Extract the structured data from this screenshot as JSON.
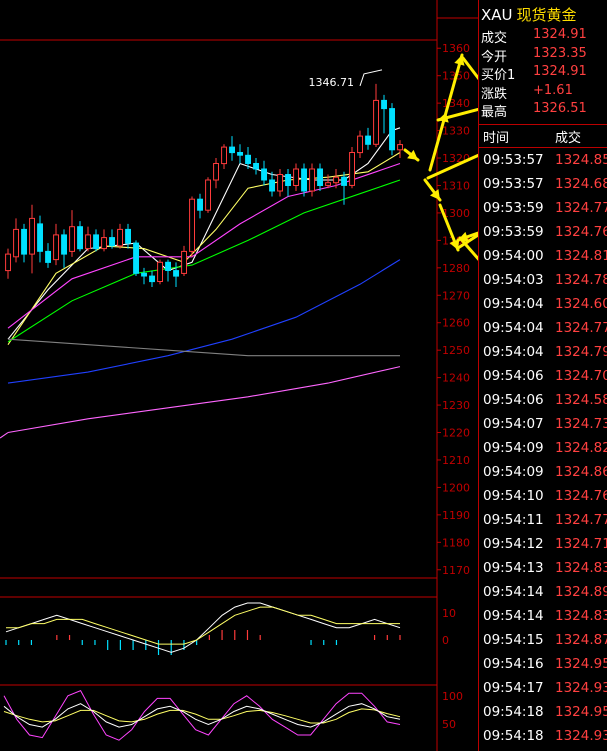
{
  "quote": {
    "symbol": "XAU",
    "name": "现货黄金",
    "rows": [
      {
        "label": "成交",
        "value": "1324.91"
      },
      {
        "label": "今开",
        "value": "1323.35"
      },
      {
        "label": "买价1",
        "value": "1324.91"
      },
      {
        "label": "涨跌",
        "value": "+1.61"
      },
      {
        "label": "最高",
        "value": "1326.51"
      }
    ]
  },
  "trades": {
    "headers": [
      "时间",
      "成交"
    ],
    "rows": [
      {
        "time": "09:53:57",
        "price": "1324.85"
      },
      {
        "time": "09:53:57",
        "price": "1324.68"
      },
      {
        "time": "09:53:59",
        "price": "1324.77"
      },
      {
        "time": "09:53:59",
        "price": "1324.76"
      },
      {
        "time": "09:54:00",
        "price": "1324.81"
      },
      {
        "time": "09:54:03",
        "price": "1324.78"
      },
      {
        "time": "09:54:04",
        "price": "1324.60"
      },
      {
        "time": "09:54:04",
        "price": "1324.77"
      },
      {
        "time": "09:54:04",
        "price": "1324.79"
      },
      {
        "time": "09:54:06",
        "price": "1324.70"
      },
      {
        "time": "09:54:06",
        "price": "1324.58"
      },
      {
        "time": "09:54:07",
        "price": "1324.73"
      },
      {
        "time": "09:54:09",
        "price": "1324.82"
      },
      {
        "time": "09:54:09",
        "price": "1324.86"
      },
      {
        "time": "09:54:10",
        "price": "1324.76"
      },
      {
        "time": "09:54:11",
        "price": "1324.77"
      },
      {
        "time": "09:54:12",
        "price": "1324.71"
      },
      {
        "time": "09:54:13",
        "price": "1324.83"
      },
      {
        "time": "09:54:14",
        "price": "1324.89"
      },
      {
        "time": "09:54:14",
        "price": "1324.83"
      },
      {
        "time": "09:54:15",
        "price": "1324.87"
      },
      {
        "time": "09:54:16",
        "price": "1324.95"
      },
      {
        "time": "09:54:17",
        "price": "1324.93"
      },
      {
        "time": "09:54:18",
        "price": "1324.95"
      },
      {
        "time": "09:54:18",
        "price": "1324.93"
      }
    ]
  },
  "colors": {
    "up": "#ff3b3b",
    "down": "#00e0ff",
    "axis": "#c00000",
    "ma5": "#ffffff",
    "ma10": "#ffff66",
    "ma20": "#ff44ff",
    "ma30": "#00ff00",
    "ma60": "#2040ff",
    "ma120": "#808080",
    "ma250": "#ff66ff",
    "arrow": "#ffee00"
  },
  "chart_data": {
    "type": "candlestick",
    "price_axis_ticks": [
      1360,
      1350,
      1340,
      1330,
      1320,
      1310,
      1300,
      1290,
      1280,
      1270,
      1260,
      1250,
      1240,
      1230,
      1220,
      1210,
      1200,
      1190,
      1180,
      1170
    ],
    "ylim": [
      1167,
      1363
    ],
    "peak_label": "1346.71",
    "candles": [
      {
        "o": 1279,
        "c": 1285,
        "h": 1287,
        "l": 1276
      },
      {
        "o": 1284,
        "c": 1294,
        "h": 1298,
        "l": 1282
      },
      {
        "o": 1294,
        "c": 1285,
        "h": 1296,
        "l": 1282
      },
      {
        "o": 1285,
        "c": 1298,
        "h": 1303,
        "l": 1278
      },
      {
        "o": 1296,
        "c": 1286,
        "h": 1299,
        "l": 1282
      },
      {
        "o": 1286,
        "c": 1282,
        "h": 1289,
        "l": 1280
      },
      {
        "o": 1283,
        "c": 1292,
        "h": 1296,
        "l": 1281
      },
      {
        "o": 1292,
        "c": 1285,
        "h": 1294,
        "l": 1280
      },
      {
        "o": 1286,
        "c": 1295,
        "h": 1301,
        "l": 1284
      },
      {
        "o": 1295,
        "c": 1287,
        "h": 1297,
        "l": 1286
      },
      {
        "o": 1287,
        "c": 1292,
        "h": 1295,
        "l": 1286
      },
      {
        "o": 1292,
        "c": 1287,
        "h": 1294,
        "l": 1286
      },
      {
        "o": 1287,
        "c": 1291,
        "h": 1294,
        "l": 1286
      },
      {
        "o": 1291,
        "c": 1288,
        "h": 1294,
        "l": 1287
      },
      {
        "o": 1288,
        "c": 1294,
        "h": 1296,
        "l": 1287
      },
      {
        "o": 1294,
        "c": 1289,
        "h": 1296,
        "l": 1287
      },
      {
        "o": 1289,
        "c": 1278,
        "h": 1290,
        "l": 1277
      },
      {
        "o": 1278,
        "c": 1277,
        "h": 1280,
        "l": 1274
      },
      {
        "o": 1277,
        "c": 1275,
        "h": 1279,
        "l": 1273
      },
      {
        "o": 1275,
        "c": 1282,
        "h": 1283,
        "l": 1274
      },
      {
        "o": 1282,
        "c": 1279,
        "h": 1283,
        "l": 1275
      },
      {
        "o": 1279,
        "c": 1277,
        "h": 1282,
        "l": 1273
      },
      {
        "o": 1278,
        "c": 1286,
        "h": 1288,
        "l": 1277
      },
      {
        "o": 1286,
        "c": 1305,
        "h": 1306,
        "l": 1284
      },
      {
        "o": 1305,
        "c": 1301,
        "h": 1307,
        "l": 1298
      },
      {
        "o": 1301,
        "c": 1312,
        "h": 1313,
        "l": 1300
      },
      {
        "o": 1312,
        "c": 1318,
        "h": 1320,
        "l": 1309
      },
      {
        "o": 1318,
        "c": 1324,
        "h": 1325,
        "l": 1316
      },
      {
        "o": 1324,
        "c": 1322,
        "h": 1328,
        "l": 1319
      },
      {
        "o": 1322,
        "c": 1321,
        "h": 1325,
        "l": 1318
      },
      {
        "o": 1321,
        "c": 1318,
        "h": 1324,
        "l": 1316
      },
      {
        "o": 1318,
        "c": 1316,
        "h": 1320,
        "l": 1314
      },
      {
        "o": 1316,
        "c": 1312,
        "h": 1319,
        "l": 1310
      },
      {
        "o": 1312,
        "c": 1308,
        "h": 1315,
        "l": 1306
      },
      {
        "o": 1308,
        "c": 1314,
        "h": 1316,
        "l": 1306
      },
      {
        "o": 1314,
        "c": 1310,
        "h": 1316,
        "l": 1306
      },
      {
        "o": 1310,
        "c": 1316,
        "h": 1318,
        "l": 1308
      },
      {
        "o": 1316,
        "c": 1308,
        "h": 1318,
        "l": 1306
      },
      {
        "o": 1308,
        "c": 1316,
        "h": 1318,
        "l": 1306
      },
      {
        "o": 1316,
        "c": 1310,
        "h": 1318,
        "l": 1308
      },
      {
        "o": 1310,
        "c": 1311,
        "h": 1314,
        "l": 1309
      },
      {
        "o": 1311,
        "c": 1313,
        "h": 1316,
        "l": 1309
      },
      {
        "o": 1313,
        "c": 1310,
        "h": 1315,
        "l": 1303
      },
      {
        "o": 1310,
        "c": 1322,
        "h": 1324,
        "l": 1309
      },
      {
        "o": 1322,
        "c": 1328,
        "h": 1330,
        "l": 1320
      },
      {
        "o": 1328,
        "c": 1325,
        "h": 1331,
        "l": 1323
      },
      {
        "o": 1325,
        "c": 1341,
        "h": 1347,
        "l": 1324
      },
      {
        "o": 1341,
        "c": 1338,
        "h": 1343,
        "l": 1329
      },
      {
        "o": 1338,
        "c": 1323,
        "h": 1340,
        "l": 1321
      },
      {
        "o": 1323,
        "c": 1324.91,
        "h": 1326.51,
        "l": 1320
      }
    ],
    "ma_lines": [
      {
        "key": "ma5",
        "points": [
          [
            0,
            1254
          ],
          [
            5,
            1272
          ],
          [
            10,
            1287
          ],
          [
            16,
            1289
          ],
          [
            20,
            1279
          ],
          [
            23,
            1282
          ],
          [
            26,
            1300
          ],
          [
            29,
            1318
          ],
          [
            33,
            1314
          ],
          [
            38,
            1312
          ],
          [
            42,
            1312
          ],
          [
            45,
            1318
          ],
          [
            48,
            1330
          ],
          [
            49,
            1331
          ]
        ]
      },
      {
        "key": "ma10",
        "points": [
          [
            0,
            1252
          ],
          [
            6,
            1278
          ],
          [
            12,
            1288
          ],
          [
            17,
            1287
          ],
          [
            22,
            1282
          ],
          [
            26,
            1294
          ],
          [
            30,
            1309
          ],
          [
            35,
            1312
          ],
          [
            40,
            1313
          ],
          [
            45,
            1315
          ],
          [
            49,
            1322
          ]
        ]
      },
      {
        "key": "ma20",
        "points": [
          [
            0,
            1258
          ],
          [
            8,
            1276
          ],
          [
            16,
            1284
          ],
          [
            23,
            1284
          ],
          [
            29,
            1296
          ],
          [
            35,
            1306
          ],
          [
            41,
            1310
          ],
          [
            46,
            1315
          ],
          [
            49,
            1318
          ]
        ]
      },
      {
        "key": "ma30",
        "points": [
          [
            0,
            1253
          ],
          [
            8,
            1268
          ],
          [
            16,
            1278
          ],
          [
            23,
            1281
          ],
          [
            30,
            1290
          ],
          [
            37,
            1300
          ],
          [
            44,
            1307
          ],
          [
            49,
            1312
          ]
        ]
      },
      {
        "key": "ma60",
        "points": [
          [
            0,
            1238
          ],
          [
            10,
            1242
          ],
          [
            20,
            1248
          ],
          [
            28,
            1254
          ],
          [
            36,
            1262
          ],
          [
            44,
            1274
          ],
          [
            49,
            1283
          ]
        ]
      },
      {
        "key": "ma120",
        "points": [
          [
            0,
            1254
          ],
          [
            10,
            1252
          ],
          [
            20,
            1250
          ],
          [
            30,
            1248
          ],
          [
            40,
            1248
          ],
          [
            49,
            1248
          ]
        ]
      },
      {
        "key": "ma250",
        "points": [
          [
            0,
            1220
          ],
          [
            10,
            1225
          ],
          [
            20,
            1229
          ],
          [
            30,
            1233
          ],
          [
            40,
            1238
          ],
          [
            49,
            1244
          ]
        ]
      }
    ],
    "macd": {
      "axis_ticks": [
        10,
        0
      ],
      "dif": [
        2,
        3,
        4,
        5,
        6,
        5,
        4,
        3,
        2,
        1,
        0,
        -1,
        -2,
        -3,
        -2,
        0,
        3,
        6,
        8,
        9,
        9,
        8,
        7,
        6,
        5,
        4,
        3,
        3,
        4,
        5,
        4,
        3
      ],
      "dea": [
        3,
        3,
        4,
        4,
        5,
        5,
        5,
        4,
        3,
        2,
        1,
        0,
        -1,
        -1,
        -1,
        0,
        2,
        4,
        6,
        7,
        8,
        8,
        7,
        6,
        6,
        5,
        4,
        4,
        4,
        4,
        4,
        4
      ],
      "bars": [
        -1,
        -1,
        -1,
        0,
        1,
        1,
        -1,
        -1,
        -2,
        -2,
        -2,
        -2,
        -3,
        -3,
        -2,
        -1,
        1,
        2,
        2,
        2,
        1,
        0,
        0,
        0,
        -1,
        -1,
        -1,
        0,
        0,
        1,
        1,
        1
      ]
    },
    "kdj": {
      "axis_ticks": [
        100,
        50
      ],
      "k": [
        80,
        60,
        45,
        40,
        55,
        75,
        85,
        70,
        50,
        40,
        45,
        60,
        75,
        80,
        70,
        55,
        45,
        55,
        70,
        80,
        75,
        65,
        55,
        45,
        40,
        50,
        65,
        80,
        85,
        75,
        60,
        55
      ],
      "d": [
        70,
        62,
        55,
        50,
        52,
        62,
        72,
        72,
        62,
        52,
        50,
        55,
        65,
        72,
        72,
        65,
        55,
        55,
        62,
        70,
        72,
        68,
        62,
        55,
        48,
        48,
        55,
        68,
        75,
        73,
        66,
        60
      ],
      "j": [
        100,
        55,
        25,
        20,
        60,
        100,
        110,
        65,
        25,
        15,
        35,
        70,
        95,
        95,
        65,
        35,
        25,
        55,
        85,
        100,
        80,
        55,
        40,
        25,
        25,
        55,
        85,
        105,
        105,
        80,
        50,
        45
      ]
    }
  }
}
